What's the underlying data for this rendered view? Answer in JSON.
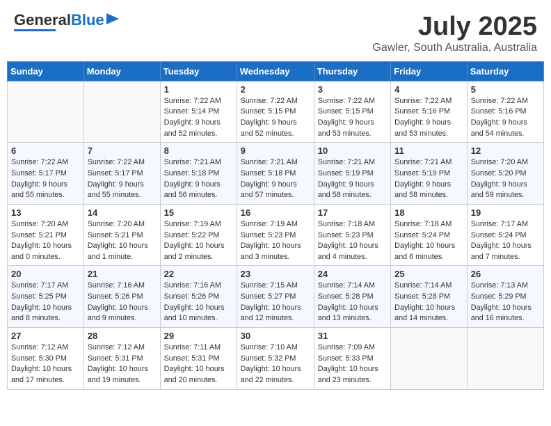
{
  "header": {
    "logo_general": "General",
    "logo_blue": "Blue",
    "title": "July 2025",
    "subtitle": "Gawler, South Australia, Australia"
  },
  "days_of_week": [
    "Sunday",
    "Monday",
    "Tuesday",
    "Wednesday",
    "Thursday",
    "Friday",
    "Saturday"
  ],
  "weeks": [
    [
      {
        "day": "",
        "info": ""
      },
      {
        "day": "",
        "info": ""
      },
      {
        "day": "1",
        "info": "Sunrise: 7:22 AM\nSunset: 5:14 PM\nDaylight: 9 hours and 52 minutes."
      },
      {
        "day": "2",
        "info": "Sunrise: 7:22 AM\nSunset: 5:15 PM\nDaylight: 9 hours and 52 minutes."
      },
      {
        "day": "3",
        "info": "Sunrise: 7:22 AM\nSunset: 5:15 PM\nDaylight: 9 hours and 53 minutes."
      },
      {
        "day": "4",
        "info": "Sunrise: 7:22 AM\nSunset: 5:16 PM\nDaylight: 9 hours and 53 minutes."
      },
      {
        "day": "5",
        "info": "Sunrise: 7:22 AM\nSunset: 5:16 PM\nDaylight: 9 hours and 54 minutes."
      }
    ],
    [
      {
        "day": "6",
        "info": "Sunrise: 7:22 AM\nSunset: 5:17 PM\nDaylight: 9 hours and 55 minutes."
      },
      {
        "day": "7",
        "info": "Sunrise: 7:22 AM\nSunset: 5:17 PM\nDaylight: 9 hours and 55 minutes."
      },
      {
        "day": "8",
        "info": "Sunrise: 7:21 AM\nSunset: 5:18 PM\nDaylight: 9 hours and 56 minutes."
      },
      {
        "day": "9",
        "info": "Sunrise: 7:21 AM\nSunset: 5:18 PM\nDaylight: 9 hours and 57 minutes."
      },
      {
        "day": "10",
        "info": "Sunrise: 7:21 AM\nSunset: 5:19 PM\nDaylight: 9 hours and 58 minutes."
      },
      {
        "day": "11",
        "info": "Sunrise: 7:21 AM\nSunset: 5:19 PM\nDaylight: 9 hours and 58 minutes."
      },
      {
        "day": "12",
        "info": "Sunrise: 7:20 AM\nSunset: 5:20 PM\nDaylight: 9 hours and 59 minutes."
      }
    ],
    [
      {
        "day": "13",
        "info": "Sunrise: 7:20 AM\nSunset: 5:21 PM\nDaylight: 10 hours and 0 minutes."
      },
      {
        "day": "14",
        "info": "Sunrise: 7:20 AM\nSunset: 5:21 PM\nDaylight: 10 hours and 1 minute."
      },
      {
        "day": "15",
        "info": "Sunrise: 7:19 AM\nSunset: 5:22 PM\nDaylight: 10 hours and 2 minutes."
      },
      {
        "day": "16",
        "info": "Sunrise: 7:19 AM\nSunset: 5:23 PM\nDaylight: 10 hours and 3 minutes."
      },
      {
        "day": "17",
        "info": "Sunrise: 7:18 AM\nSunset: 5:23 PM\nDaylight: 10 hours and 4 minutes."
      },
      {
        "day": "18",
        "info": "Sunrise: 7:18 AM\nSunset: 5:24 PM\nDaylight: 10 hours and 6 minutes."
      },
      {
        "day": "19",
        "info": "Sunrise: 7:17 AM\nSunset: 5:24 PM\nDaylight: 10 hours and 7 minutes."
      }
    ],
    [
      {
        "day": "20",
        "info": "Sunrise: 7:17 AM\nSunset: 5:25 PM\nDaylight: 10 hours and 8 minutes."
      },
      {
        "day": "21",
        "info": "Sunrise: 7:16 AM\nSunset: 5:26 PM\nDaylight: 10 hours and 9 minutes."
      },
      {
        "day": "22",
        "info": "Sunrise: 7:16 AM\nSunset: 5:26 PM\nDaylight: 10 hours and 10 minutes."
      },
      {
        "day": "23",
        "info": "Sunrise: 7:15 AM\nSunset: 5:27 PM\nDaylight: 10 hours and 12 minutes."
      },
      {
        "day": "24",
        "info": "Sunrise: 7:14 AM\nSunset: 5:28 PM\nDaylight: 10 hours and 13 minutes."
      },
      {
        "day": "25",
        "info": "Sunrise: 7:14 AM\nSunset: 5:28 PM\nDaylight: 10 hours and 14 minutes."
      },
      {
        "day": "26",
        "info": "Sunrise: 7:13 AM\nSunset: 5:29 PM\nDaylight: 10 hours and 16 minutes."
      }
    ],
    [
      {
        "day": "27",
        "info": "Sunrise: 7:12 AM\nSunset: 5:30 PM\nDaylight: 10 hours and 17 minutes."
      },
      {
        "day": "28",
        "info": "Sunrise: 7:12 AM\nSunset: 5:31 PM\nDaylight: 10 hours and 19 minutes."
      },
      {
        "day": "29",
        "info": "Sunrise: 7:11 AM\nSunset: 5:31 PM\nDaylight: 10 hours and 20 minutes."
      },
      {
        "day": "30",
        "info": "Sunrise: 7:10 AM\nSunset: 5:32 PM\nDaylight: 10 hours and 22 minutes."
      },
      {
        "day": "31",
        "info": "Sunrise: 7:09 AM\nSunset: 5:33 PM\nDaylight: 10 hours and 23 minutes."
      },
      {
        "day": "",
        "info": ""
      },
      {
        "day": "",
        "info": ""
      }
    ]
  ]
}
